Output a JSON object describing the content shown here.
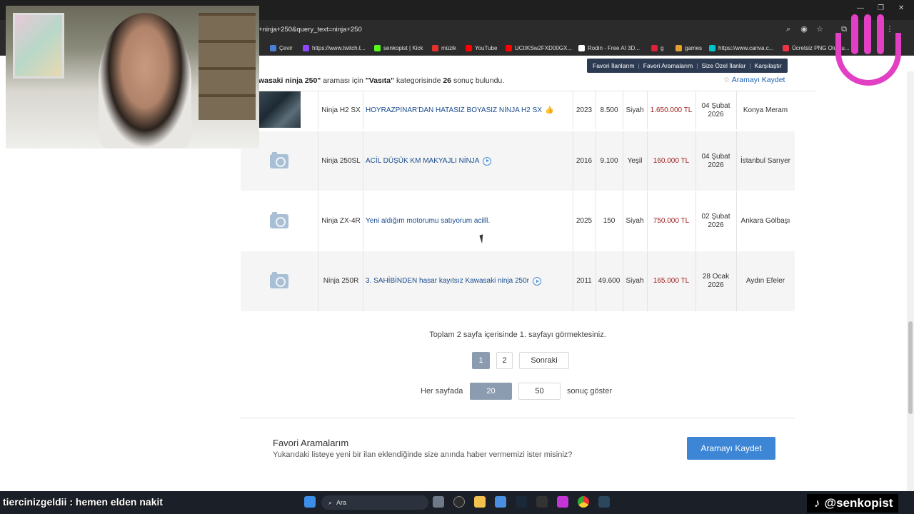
{
  "browser": {
    "address": "+ninja+250&query_text=ninja+250",
    "bookmarks": [
      {
        "label": "Çevir",
        "color": "#4a7fd8"
      },
      {
        "label": "https://www.twitch.t...",
        "color": "#9146ff"
      },
      {
        "label": "senkopist | Kick",
        "color": "#53fc18"
      },
      {
        "label": "müzik",
        "color": "#e5322d"
      },
      {
        "label": "YouTube",
        "color": "#ff0000"
      },
      {
        "label": "UCtIKSw2FXD00GX...",
        "color": "#ff0000"
      },
      {
        "label": "Rodin - Free AI 3D...",
        "color": "#ffffff"
      },
      {
        "label": "g",
        "color": "#d23"
      },
      {
        "label": "games",
        "color": "#e0a030"
      },
      {
        "label": "https://www.canva.c...",
        "color": "#00c4cc"
      },
      {
        "label": "Ücretsiz PNG Oluştu...",
        "color": "#e34"
      }
    ]
  },
  "nav": {
    "links": [
      "Favori İlanlarım",
      "Favori Aramalarım",
      "Size Özel İlanlar",
      "Karşılaştır"
    ]
  },
  "summary": {
    "query": "wasaki ninja 250\"",
    "middle": " araması için ",
    "category": "\"Vasıta\"",
    "middle2": " kategorisinde ",
    "count": "26",
    "suffix": " sonuç bulundu."
  },
  "save_search_top": "Aramayı Kaydet",
  "listings": [
    {
      "model": "Ninja H2 SX",
      "title": "HOYRAZPINAR'DAN HATASIZ BOYASIZ NİNJA H2 SX",
      "year": "2023",
      "km": "8.500",
      "color": "Siyah",
      "price": "1.650.000 TL",
      "date": "04 Şubat 2026",
      "location": "Konya Meram",
      "has_photo": true,
      "badge": "thumb"
    },
    {
      "model": "Ninja 250SL",
      "title": "ACİL DÜŞÜK KM MAKYAJLI NİNJA",
      "year": "2016",
      "km": "9.100",
      "color": "Yeşil",
      "price": "160.000 TL",
      "date": "04 Şubat 2026",
      "location": "İstanbul Sarıyer",
      "has_photo": false,
      "badge": "play"
    },
    {
      "model": "Ninja ZX-4R",
      "title": "Yeni aldığım motorumu satıyorum acilll.",
      "year": "2025",
      "km": "150",
      "color": "Siyah",
      "price": "750.000 TL",
      "date": "02 Şubat 2026",
      "location": "Ankara Gölbaşı",
      "has_photo": false,
      "badge": ""
    },
    {
      "model": "Ninja 250R",
      "title": "3. SAHİBİNDEN hasar kayıtsız Kawasaki ninja 250r",
      "year": "2011",
      "km": "49.600",
      "color": "Siyah",
      "price": "165.000 TL",
      "date": "28 Ocak 2026",
      "location": "Aydın Efeler",
      "has_photo": false,
      "badge": "play"
    }
  ],
  "pagination": {
    "info": "Toplam 2 sayfa içerisinde 1. sayfayı görmektesiniz.",
    "pages": [
      "1",
      "2"
    ],
    "current_page": "1",
    "next": "Sonraki",
    "per_page_label": "Her sayfada",
    "per_page_options": [
      "20",
      "50"
    ],
    "per_page_selected": "20",
    "per_page_suffix": "sonuç göster"
  },
  "favorites": {
    "title": "Favori Aramalarım",
    "description": "Yukarıdaki listeye yeni bir ilan eklendiğinde size anında haber vermemizi ister misiniz?",
    "button": "Aramayı Kaydet"
  },
  "stream": {
    "chat_message": "tiercinizgeldii : hemen elden nakit",
    "handle": "@senkopist"
  },
  "taskbar": {
    "search_placeholder": "Ara"
  },
  "colors": {
    "nav_bg": "#2d3b52",
    "link": "#1a4d8f",
    "price": "#9c1c1c",
    "primary_button": "#3d86d6",
    "overlay_logo": "#e23fc4"
  }
}
